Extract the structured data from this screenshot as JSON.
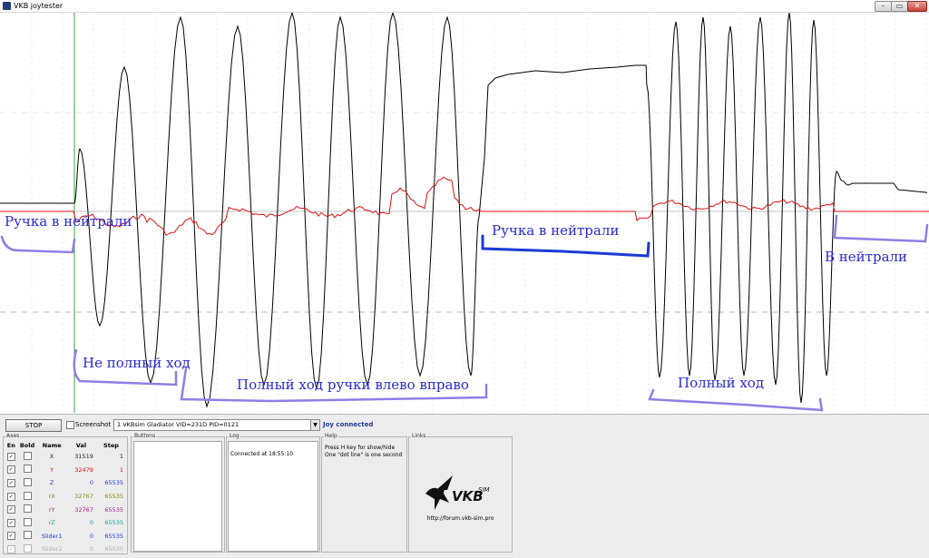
{
  "window": {
    "title": "VKB joytester",
    "controls": {
      "minimize": "–",
      "maximize": "▭",
      "close": "✕"
    }
  },
  "annotations": {
    "neutral_left": "Ручка в нейтрали",
    "partial_travel": "Не полный ход",
    "full_travel_lr": "Полный ход ручки влево вправо",
    "neutral_mid": "Ручка в нейтрали",
    "full_travel": "Полный ход",
    "neutral_right": "В нейтрали"
  },
  "colors": {
    "trace_main": "#000000",
    "trace_secondary": "#e01010",
    "annotation_text": "#2b2bd0",
    "annotation_bracket": "#8c80e8",
    "annotation_bracket_bold": "#1d3ad8",
    "cursor_line": "#3ca03c"
  },
  "toolbar": {
    "stop_label": "STOP",
    "screenshot_label": "Screenshot",
    "device": "1 VKBsim Gladiator  VID=231D PID=0121",
    "status": "Joy connected"
  },
  "axes": {
    "title": "Axes",
    "headers": {
      "en": "En",
      "bold": "Bold",
      "name": "Name",
      "val": "Val",
      "step": "Step"
    },
    "rows": [
      {
        "name": "X",
        "val": "31519",
        "step": "1",
        "color": "#2a2a2a"
      },
      {
        "name": "Y",
        "val": "32479",
        "step": "1",
        "color": "#e01010"
      },
      {
        "name": "Z",
        "val": "0",
        "step": "65535",
        "color": "#1a3fe0"
      },
      {
        "name": "rX",
        "val": "32767",
        "step": "65535",
        "color": "#8a8a12"
      },
      {
        "name": "rY",
        "val": "32767",
        "step": "65535",
        "color": "#a02890"
      },
      {
        "name": "rZ",
        "val": "0",
        "step": "65535",
        "color": "#14a0a0"
      },
      {
        "name": "Slider1",
        "val": "0",
        "step": "65535",
        "color": "#1a3fe0"
      },
      {
        "name": "Slider2",
        "val": "0",
        "step": "65535",
        "color": "#b0b0b0"
      }
    ]
  },
  "buttons": {
    "title": "Buttons"
  },
  "log": {
    "title": "Log",
    "entry": "Connected at 18:55:10"
  },
  "help": {
    "title": "Help",
    "line1": "Press H key for show/hide",
    "line2": "One \"dot line\" is one second"
  },
  "links": {
    "title": "Links",
    "logo_text": "VKB",
    "logo_sup": "SIM",
    "url": "http://forum.vkb-sim.pro"
  }
}
